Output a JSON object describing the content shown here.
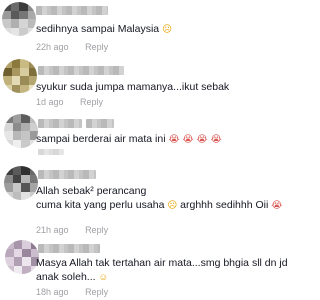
{
  "comments": [
    {
      "text": "sedihnya sampai Malaysia",
      "emojis": [
        "☹"
      ],
      "time": "22h ago",
      "reply": "Reply"
    },
    {
      "text": "syukur suda jumpa mamanya...ikut sebak",
      "emojis": [],
      "time": "1d ago",
      "reply": "Reply"
    },
    {
      "text": "sampai berderai air mata ini",
      "emojis": [
        "😭",
        "😭",
        "😭",
        "😭"
      ],
      "time": "",
      "reply": ""
    },
    {
      "line1": "Allah sebak² perancang",
      "line2": "cuma kita yang perlu usaha",
      "emojis": [
        "☹"
      ],
      "line2_tail": "arghhh sedihhh Oii",
      "emojis2": [
        "😭"
      ],
      "time": "21h ago",
      "reply": "Reply"
    },
    {
      "line1": "Masya Allah tak tertahan air mata...smg bhgia sll dn jd",
      "line2": "anak soleh...",
      "emojis": [
        "☺"
      ],
      "time": "18h ago",
      "reply": "Reply"
    }
  ]
}
